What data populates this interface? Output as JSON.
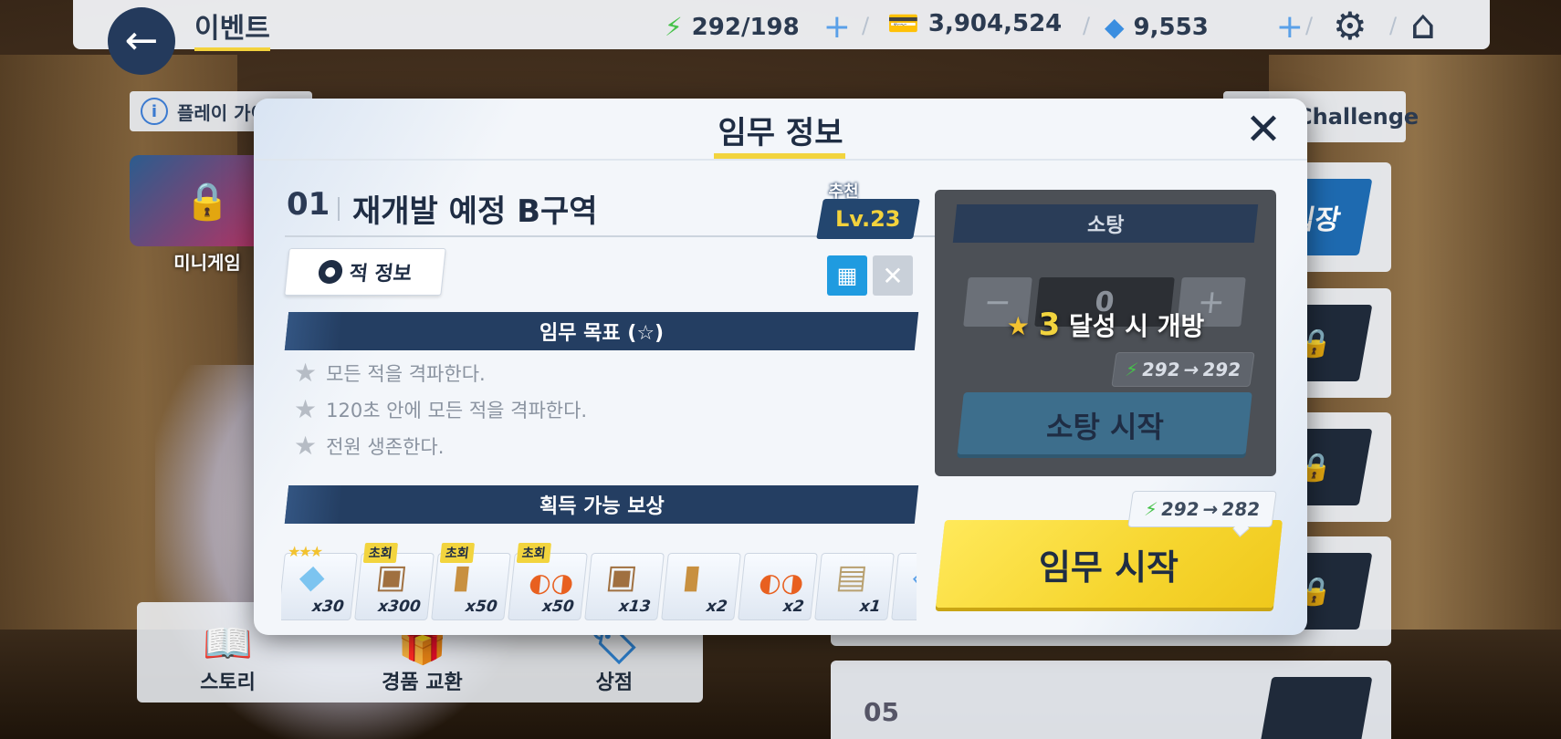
{
  "topbar": {
    "title": "이벤트",
    "ap": "292/198",
    "credits": "3,904,524",
    "gems": "9,553"
  },
  "background": {
    "play_guide": "플레이 가이드",
    "challenge_tab": "Challenge",
    "minigame_label": "미니게임",
    "stage_cards": [
      {
        "num": "",
        "button": "입장",
        "locked": false
      },
      {
        "num": "",
        "button": "🔒",
        "locked": true
      },
      {
        "num": "",
        "button": "🔒",
        "locked": true
      },
      {
        "num": "",
        "button": "🔒",
        "locked": true
      },
      {
        "num": "05",
        "button": "",
        "locked": true
      }
    ],
    "bottom_menu": [
      {
        "label": "스토리",
        "icon": "book-icon"
      },
      {
        "label": "경품 교환",
        "icon": "gift-icon"
      },
      {
        "label": "상점",
        "icon": "shop-icon"
      }
    ]
  },
  "modal": {
    "title": "임무 정보",
    "stage_number": "01",
    "stage_name": "재개발 예정 B구역",
    "recommend_label": "추천",
    "recommend_level": "Lv.23",
    "enemy_info_label": "적 정보",
    "objectives_header": "임무 목표 (☆)",
    "objectives": [
      "모든 적을 격파한다.",
      "120초 안에 모든 적을 격파한다.",
      "전원 생존한다."
    ],
    "rewards_header": "획득 가능 보상",
    "rewards": [
      {
        "icon": "crystal-icon",
        "qty": "x30",
        "tag": "",
        "stars": "★★★"
      },
      {
        "icon": "box-icon",
        "qty": "x300",
        "tag": "초회",
        "stars": ""
      },
      {
        "icon": "popsicle-icon",
        "qty": "x50",
        "tag": "초회",
        "stars": ""
      },
      {
        "icon": "sunglasses-icon",
        "qty": "x50",
        "tag": "초회",
        "stars": ""
      },
      {
        "icon": "box-icon",
        "qty": "x13",
        "tag": "",
        "stars": ""
      },
      {
        "icon": "popsicle-icon",
        "qty": "x2",
        "tag": "",
        "stars": ""
      },
      {
        "icon": "sunglasses-icon",
        "qty": "x2",
        "tag": "",
        "stars": ""
      },
      {
        "icon": "map-icon",
        "qty": "x1",
        "tag": "",
        "stars": ""
      },
      {
        "icon": "item-icon",
        "qty": "",
        "tag": "",
        "stars": ""
      }
    ],
    "sweep": {
      "title": "소탕",
      "minus": "−",
      "value": "0",
      "plus": "+",
      "lock_stars": "3",
      "lock_text": "달성 시 개방",
      "cost_from": "292",
      "cost_to": "292",
      "start_label": "소탕 시작"
    },
    "mission": {
      "cost_from": "292",
      "cost_to": "282",
      "start_label": "임무 시작"
    }
  },
  "colors": {
    "navy": "#243e62",
    "accent_yellow": "#f2d43e",
    "ap_green": "#46c24a"
  }
}
